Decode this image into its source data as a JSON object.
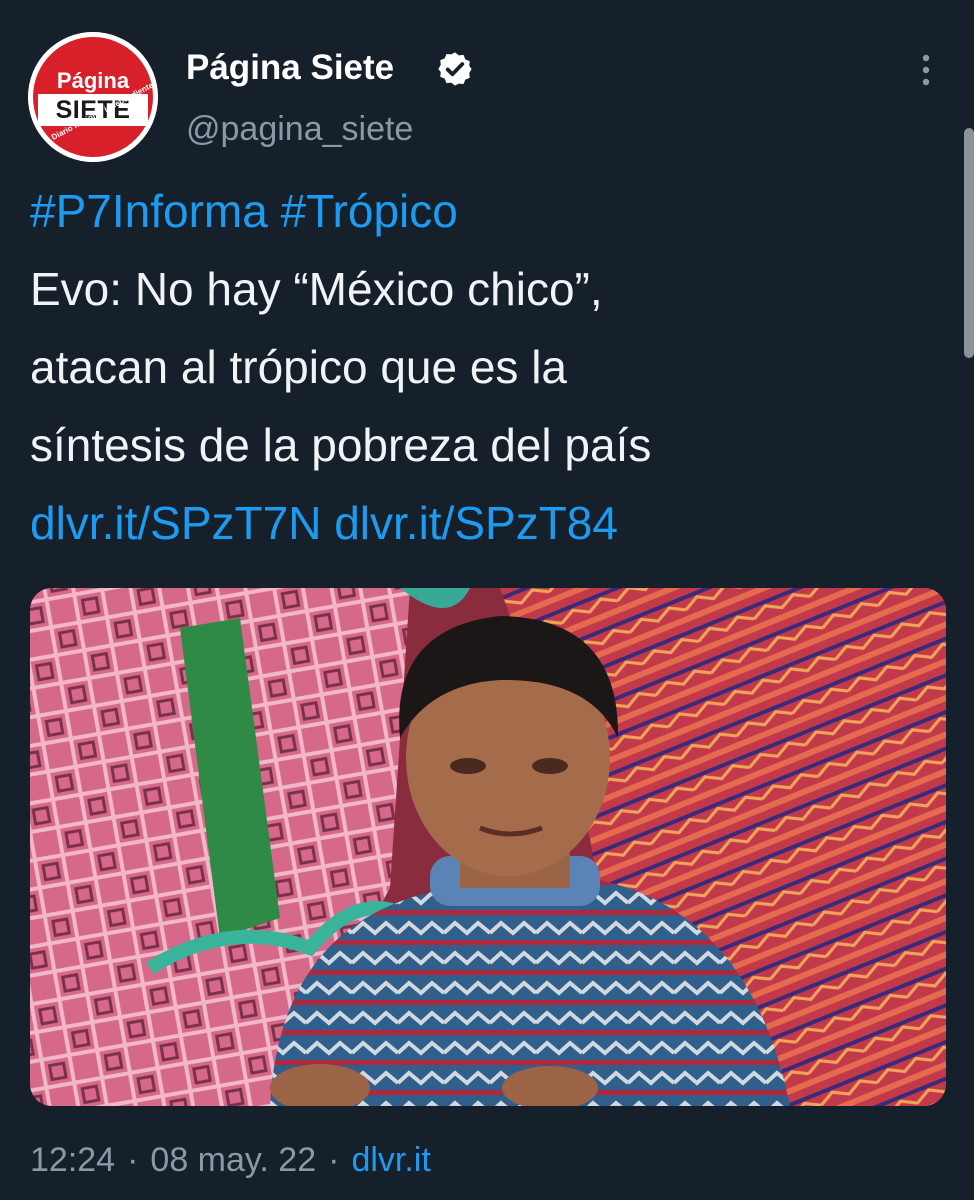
{
  "author": {
    "display_name": "Página Siete",
    "handle": "@pagina_siete",
    "avatar_text_top": "Página",
    "avatar_text_bottom": "SIETE",
    "avatar_tagline": "Diario nacional independiente",
    "verified": true
  },
  "tweet": {
    "hashtags": [
      "#P7Informa",
      "#Trópico"
    ],
    "text_lines": [
      "Evo: No hay “México chico”,",
      "atacan al trópico que es la",
      "síntesis de la pobreza del país"
    ],
    "links": [
      "dlvr.it/SPzT7N",
      "dlvr.it/SPzT84"
    ]
  },
  "meta": {
    "time": "12:24",
    "date": "08 may. 22",
    "source": "dlvr.it"
  },
  "icons": {
    "verified": "verified-badge-icon",
    "more": "more-options-icon"
  },
  "colors": {
    "background": "#15202b",
    "link": "#1d9bf0",
    "secondary_text": "#8b98a5",
    "avatar_red": "#d8202a"
  }
}
